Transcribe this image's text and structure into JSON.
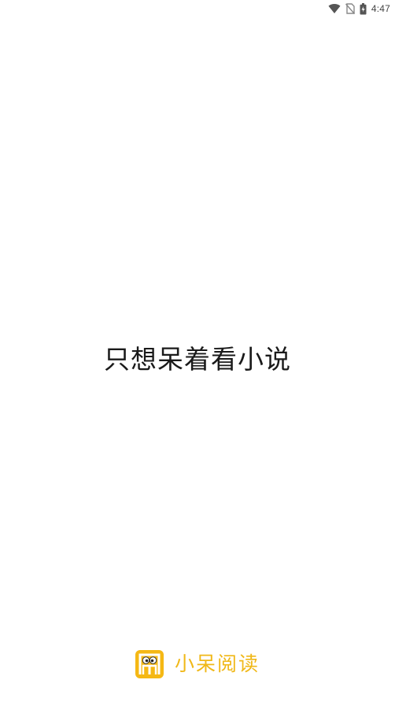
{
  "status_bar": {
    "time": "4:47",
    "icons": [
      "wifi-icon",
      "no-sim-icon",
      "battery-icon"
    ]
  },
  "splash": {
    "slogan": "只想呆着看小说"
  },
  "brand": {
    "logo_icon": "xiaodai-reader-logo-icon",
    "name": "小呆阅读",
    "accent_color": "#f0b818"
  }
}
